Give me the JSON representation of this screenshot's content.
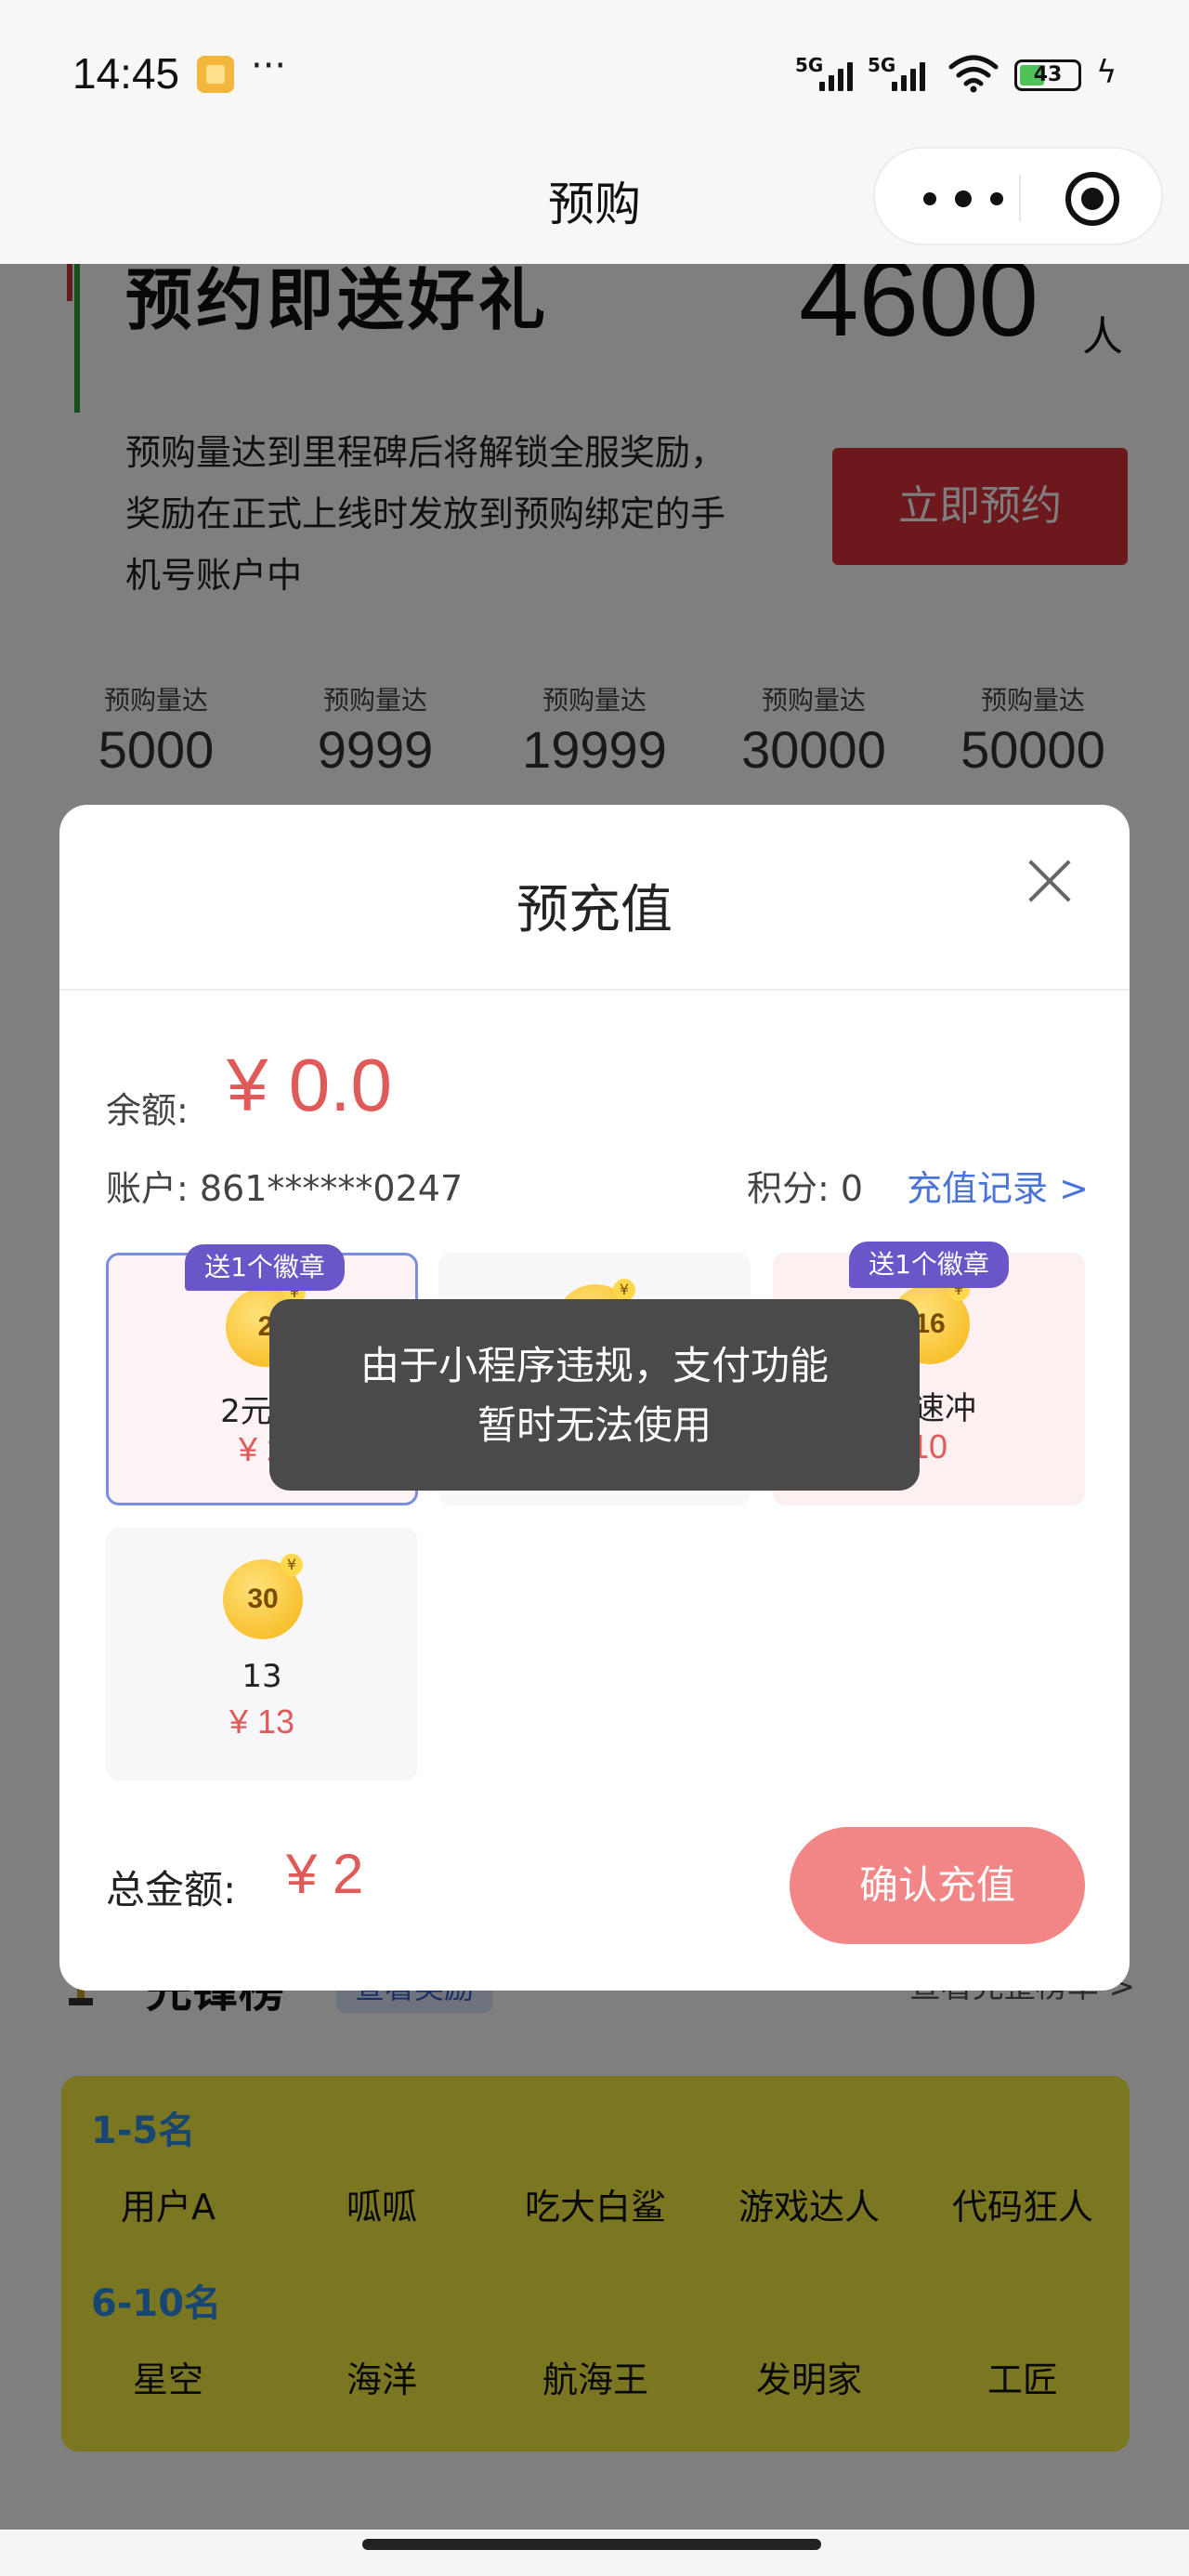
{
  "status_bar": {
    "time": "14:45",
    "more": "···",
    "network1": "5G",
    "network2": "5G",
    "battery": "43"
  },
  "nav": {
    "title": "预购"
  },
  "promo": {
    "heading": "预约即送好礼",
    "count": "4600",
    "unit": "人",
    "description": "预购量达到里程碑后将解锁全服奖励，奖励在正式上线时发放到预购绑定的手机号账户中",
    "reserve_button": "立即预约"
  },
  "milestones": [
    {
      "label": "预购量达",
      "value": "5000"
    },
    {
      "label": "预购量达",
      "value": "9999"
    },
    {
      "label": "预购量达",
      "value": "19999"
    },
    {
      "label": "预购量达",
      "value": "30000"
    },
    {
      "label": "预购量达",
      "value": "50000"
    }
  ],
  "modal": {
    "title": "预充值",
    "balance_label": "余额:",
    "balance_value": "¥ 0.0",
    "account_text": "账户: 861******0247",
    "points_text": "积分: 0",
    "recharge_record": "充值记录 >",
    "packages": [
      {
        "badge": "送1个徽章",
        "coin": "2",
        "name": "2元尝",
        "price": "¥ 2",
        "selected": true
      },
      {
        "badge": "",
        "coin": "",
        "name": "",
        "price": "",
        "selected": false
      },
      {
        "badge": "送1个徽章",
        "coin": "16",
        "name": "元速冲",
        "price": "10",
        "selected": false
      },
      {
        "badge": "",
        "coin": "30",
        "name": "13",
        "price": "¥ 13",
        "selected": false
      }
    ],
    "coin_mark": "¥",
    "total_label": "总金额:",
    "total_value": "¥ 2",
    "confirm_button": "确认充值"
  },
  "toast": {
    "line1": "由于小程序违规，支付功能",
    "line2": "暂时无法使用"
  },
  "ranking": {
    "title": "先锋榜",
    "view_reward": "查看奖励",
    "full_rank": "查看完整榜单 >",
    "group1_label": "1-5名",
    "group1": [
      "用户A",
      "呱呱",
      "吃大白鲨",
      "游戏达人",
      "代码狂人"
    ],
    "group2_label": "6-10名",
    "group2": [
      "星空",
      "海洋",
      "航海王",
      "发明家",
      "工匠"
    ]
  }
}
